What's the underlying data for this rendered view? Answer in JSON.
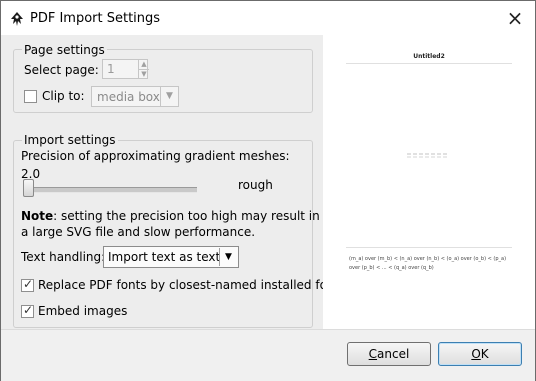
{
  "window": {
    "title": "PDF Import Settings",
    "close_glyph": "×",
    "app_icon": "inkscape-icon"
  },
  "page_settings": {
    "section_label": "Page settings",
    "select_page_label": "Select page:",
    "select_page_value": "1",
    "clip_to_label": "Clip to:",
    "clip_to_checked": false,
    "clip_to_value": "media box"
  },
  "import_settings": {
    "section_label": "Import settings",
    "precision_label": "Precision of approximating gradient meshes:",
    "precision_value": "2.0",
    "precision_level": 0.0,
    "rough_label": "rough",
    "note_bold": "Note",
    "note_line1": ": setting the precision too high may result in",
    "note_line2": "a large SVG file and slow performance.",
    "text_handling_label": "Text handling:",
    "text_handling_value": "Import text as text",
    "replace_fonts_label": "Replace PDF fonts by closest-named installed fonts",
    "replace_fonts_checked": true,
    "embed_images_label": "Embed images",
    "embed_images_checked": true
  },
  "preview": {
    "page_title": "Untitled2",
    "footer_line1": "(m_a) over (m_b) < (n_a) over (n_b) < (o_a) over (o_b) < (p_a)",
    "footer_line2": "over (p_b) < ... < (q_a) over (q_b)"
  },
  "buttons": {
    "cancel_mnemonic": "C",
    "cancel_rest": "ancel",
    "ok_mnemonic": "O",
    "ok_rest": "K"
  }
}
